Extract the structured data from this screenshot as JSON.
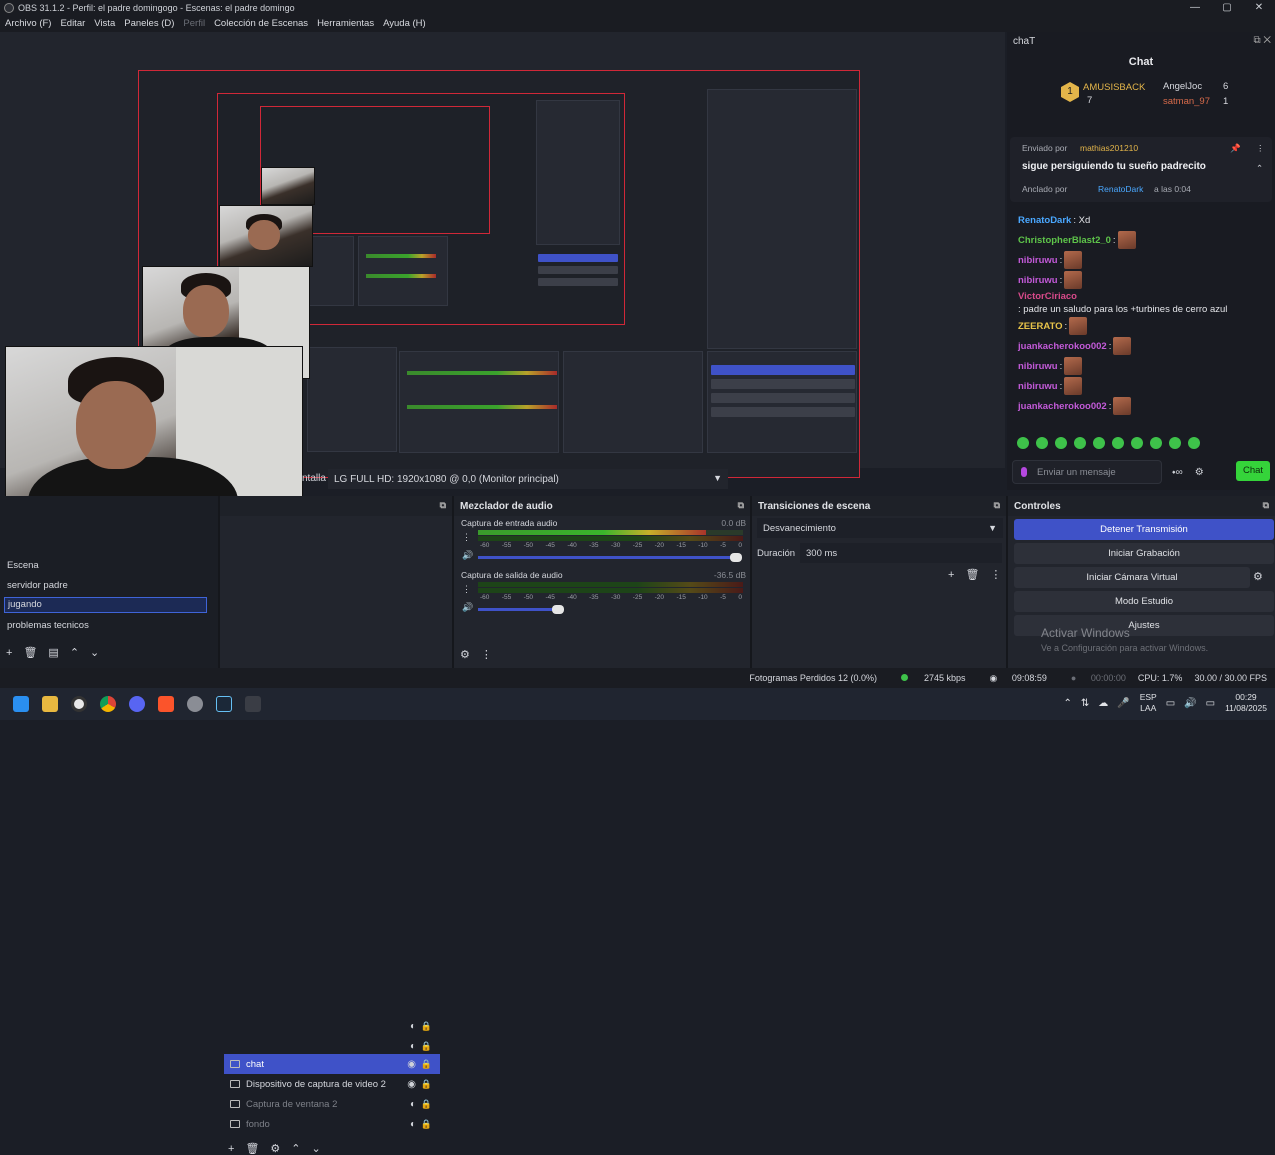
{
  "window": {
    "title": "OBS 31.1.2 - Perfil: el padre domingogo - Escenas: el padre domingo",
    "controls": [
      "—",
      "▢",
      "✕"
    ]
  },
  "menu": {
    "items": [
      "Archivo (F)",
      "Editar",
      "Vista",
      "Paneles (D)",
      "Perfil",
      "Colección de Escenas",
      "Herramientas",
      "Ayuda (H)"
    ]
  },
  "preview": {
    "screen_label": "ntalla",
    "screen_value": "LG FULL HD: 1920x1080 @ 0,0 (Monitor principal)"
  },
  "chat": {
    "dock_title": "chaT",
    "title": "Chat",
    "leaderboard": {
      "first_name": "AMUSISBACK",
      "first_rank": "1",
      "first_count": "7",
      "second_name": "AngelJoc",
      "second_count": "6",
      "third_name": "satman_97",
      "third_count": "1"
    },
    "pinned": {
      "sent_by_prefix": "Enviado por",
      "sent_by_user": "mathias201210",
      "message": "sigue persiguiendo tu sueño padrecito",
      "pinned_by_prefix": "Anclado por",
      "pinned_by_user": "RenatoDark",
      "pinned_time": "a las 0:04"
    },
    "messages": [
      {
        "user": "RenatoDark",
        "text": ": Xd",
        "color": "#4aa8ff",
        "emotes": 0
      },
      {
        "user": "ChristopherBlast2_0",
        "text": ":",
        "color": "#5ec44a",
        "emotes": 1
      },
      {
        "user": "nibiruwu",
        "text": ":",
        "color": "#c25ad8",
        "emotes": 1
      },
      {
        "user": "nibiruwu",
        "text": ":",
        "color": "#c25ad8",
        "emotes": 1
      },
      {
        "user": "VictorCiriaco",
        "text": ": padre un saludo para los +turbines de cerro azul",
        "color": "#d84a8a",
        "emotes": 0
      },
      {
        "user": "ZEERATO",
        "text": ":",
        "color": "#e8c44a",
        "emotes": 1
      },
      {
        "user": "juankacherokoo002",
        "text": ":",
        "color": "#c25ad8",
        "emotes": 1
      },
      {
        "user": "nibiruwu",
        "text": ":",
        "color": "#c25ad8",
        "emotes": 1
      },
      {
        "user": "nibiruwu",
        "text": ":",
        "color": "#c25ad8",
        "emotes": 1
      },
      {
        "user": "juankacherokoo002",
        "text": ":",
        "color": "#c25ad8",
        "emotes": 1
      }
    ],
    "input_placeholder": "Enviar un mensaje",
    "send_label": "Chat"
  },
  "scenes": {
    "items": [
      "Escena",
      "servidor padre",
      "jugando",
      "problemas tecnicos"
    ],
    "selected": "jugando"
  },
  "sources": {
    "items": [
      {
        "label": "chat",
        "state": "sel"
      },
      {
        "label": "Dispositivo de captura de video 2",
        "state": "normal"
      },
      {
        "label": "Captura de ventana 2",
        "state": "dim"
      },
      {
        "label": "fondo",
        "state": "dim"
      }
    ]
  },
  "mixer": {
    "title": "Mezclador de audio",
    "tracks": [
      {
        "name": "Captura de entrada audio",
        "db": "0.0 dB"
      },
      {
        "name": "Captura de salida de audio",
        "db": "-36.5 dB"
      }
    ],
    "ticks": [
      "-60",
      "-55",
      "-50",
      "-45",
      "-40",
      "-35",
      "-30",
      "-25",
      "-20",
      "-15",
      "-10",
      "-5",
      "0"
    ]
  },
  "transitions": {
    "title": "Transiciones de escena",
    "selected": "Desvanecimiento",
    "duration_label": "Duración",
    "duration_value": "300 ms"
  },
  "controls": {
    "title": "Controles",
    "buttons": [
      "Detener Transmisión",
      "Iniciar Grabación",
      "Iniciar Cámara Virtual",
      "Modo Estudio",
      "Ajustes"
    ],
    "watermark_title": "Activar Windows",
    "watermark_sub": "Ve a Configuración para activar Windows."
  },
  "status": {
    "dropped": "Fotogramas Perdidos 12 (0.0%)",
    "bitrate": "2745 kbps",
    "stream_time": "09:08:59",
    "rec_time": "00:00:00",
    "cpu": "CPU: 1.7%",
    "fps": "30.00 / 30.00 FPS"
  },
  "taskbar": {
    "lang1": "ESP",
    "lang2": "LAA",
    "time": "00:29",
    "date": "11/08/2025"
  }
}
